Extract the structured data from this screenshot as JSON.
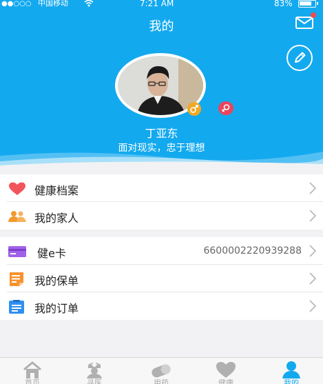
{
  "status_bar": {
    "signal": "●●○○○",
    "carrier": "中国移动",
    "time": "7:21 AM",
    "battery": "83%",
    "battery_level": 0.83
  },
  "header": {
    "title": "我的",
    "mail_icon": "mail-icon",
    "edit_icon": "pencil-icon"
  },
  "profile": {
    "name": "丁亚东",
    "motto": "面对现实，忠于理想",
    "gender_icons": [
      "male-icon",
      "female-icon"
    ]
  },
  "menu_groups": [
    {
      "items": [
        {
          "label": "健康档案",
          "icon": "heart-icon",
          "value": ""
        },
        {
          "label": "我的家人",
          "icon": "family-icon",
          "value": ""
        }
      ]
    },
    {
      "items": [
        {
          "label": "健e卡",
          "icon": "card-icon",
          "value": "6600002220939288"
        },
        {
          "label": "我的保单",
          "icon": "policy-icon",
          "value": ""
        },
        {
          "label": "我的订单",
          "icon": "order-icon",
          "value": ""
        }
      ]
    }
  ],
  "tabbar": {
    "tabs": [
      {
        "label": "首页",
        "icon": "home-icon"
      },
      {
        "label": "寻医",
        "icon": "doctor-icon"
      },
      {
        "label": "用药",
        "icon": "pill-icon"
      },
      {
        "label": "健康",
        "icon": "heart-icon"
      },
      {
        "label": "我的",
        "icon": "user-icon"
      }
    ],
    "active_index": 4
  },
  "colors": {
    "accent": "#13a9ef",
    "badge_red": "#f04c4c",
    "male_badge": "#f0a826",
    "female_badge": "#e9455d",
    "heart": "#f2545b",
    "family": "#f39a2d",
    "card": "#a161e8",
    "policy": "#f7932e",
    "order": "#2f8ff0"
  }
}
